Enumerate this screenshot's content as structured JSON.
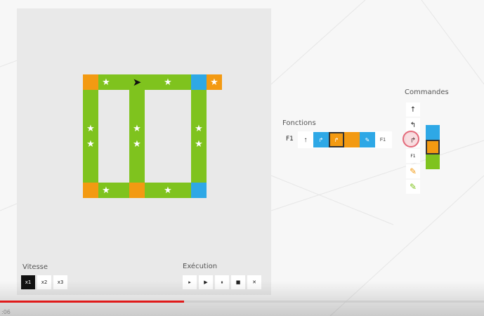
{
  "colors": {
    "green": "#7fc31e",
    "orange": "#f39a12",
    "blue": "#2ea8e6",
    "progress_red": "#e01b1b"
  },
  "board": {
    "tiles": [
      {
        "c": "orange",
        "s": ""
      },
      {
        "c": "green",
        "s": "★"
      },
      {
        "c": "green",
        "s": ""
      },
      {
        "c": "green",
        "s": "➤",
        "arrow": true
      },
      {
        "c": "green",
        "s": ""
      },
      {
        "c": "green",
        "s": "★"
      },
      {
        "c": "green",
        "s": ""
      },
      {
        "c": "blue",
        "s": ""
      },
      {
        "c": "orange",
        "s": "★"
      },
      {
        "c": "green",
        "s": ""
      },
      {
        "c": "green",
        "s": ""
      },
      {
        "c": "green",
        "s": ""
      },
      {
        "c": "green",
        "s": ""
      },
      {
        "c": "green",
        "s": ""
      },
      {
        "c": "green",
        "s": ""
      },
      {
        "c": "green",
        "s": "★"
      },
      {
        "c": "green",
        "s": "★"
      },
      {
        "c": "green",
        "s": "★"
      },
      {
        "c": "green",
        "s": "★"
      },
      {
        "c": "green",
        "s": "★"
      },
      {
        "c": "green",
        "s": "★"
      },
      {
        "c": "green",
        "s": ""
      },
      {
        "c": "green",
        "s": ""
      },
      {
        "c": "green",
        "s": ""
      },
      {
        "c": "green",
        "s": ""
      },
      {
        "c": "green",
        "s": ""
      },
      {
        "c": "green",
        "s": ""
      },
      {
        "c": "orange",
        "s": ""
      },
      {
        "c": "green",
        "s": "★"
      },
      {
        "c": "green",
        "s": ""
      },
      {
        "c": "orange",
        "s": ""
      },
      {
        "c": "green",
        "s": ""
      },
      {
        "c": "green",
        "s": "★"
      },
      {
        "c": "green",
        "s": ""
      },
      {
        "c": "blue",
        "s": ""
      }
    ]
  },
  "speed": {
    "label": "Vitesse",
    "options": [
      {
        "label": "x1",
        "active": true
      },
      {
        "label": "x2",
        "active": false
      },
      {
        "label": "x3",
        "active": false
      }
    ]
  },
  "execution": {
    "label": "Exécution",
    "buttons": [
      {
        "name": "play-step-button",
        "glyph": "▸"
      },
      {
        "name": "play-button",
        "glyph": "▶"
      },
      {
        "name": "pause-button",
        "glyph": "⏸"
      },
      {
        "name": "stop-button",
        "glyph": "■"
      },
      {
        "name": "clear-button",
        "glyph": "✕"
      }
    ]
  },
  "functions": {
    "label": "Fonctions",
    "f1_label": "F1",
    "slots": [
      {
        "style": "white",
        "glyph": "↑",
        "icon": "arrow-up-icon"
      },
      {
        "style": "blue",
        "glyph": "↱",
        "icon": "turn-right-icon"
      },
      {
        "style": "orange",
        "glyph": "↱",
        "icon": "turn-right-icon",
        "selected": true
      },
      {
        "style": "orange",
        "glyph": "",
        "icon": ""
      },
      {
        "style": "blue",
        "glyph": "✎",
        "icon": "pencil-icon"
      },
      {
        "style": "f1txt",
        "glyph": "F1",
        "icon": "f1-call-icon"
      }
    ]
  },
  "commands": {
    "label": "Commandes",
    "items": [
      {
        "name": "cmd-forward",
        "glyph": "↑",
        "icon": "arrow-up-icon",
        "cls": ""
      },
      {
        "name": "cmd-turn-left",
        "glyph": "↰",
        "icon": "turn-left-icon",
        "cls": ""
      },
      {
        "name": "cmd-turn-right",
        "glyph": "↱",
        "icon": "turn-right-icon",
        "cls": ""
      },
      {
        "name": "cmd-f1",
        "glyph": "F1",
        "icon": "f1-call-icon",
        "cls": "small"
      },
      {
        "name": "cmd-paint-orange",
        "glyph": "✎",
        "icon": "pencil-orange-icon",
        "cls": "pencil-orange"
      },
      {
        "name": "cmd-paint-green",
        "glyph": "✎",
        "icon": "pencil-green-icon",
        "cls": "pencil-green"
      }
    ],
    "condition_colors": [
      "blue",
      "orange",
      "green"
    ]
  },
  "video": {
    "progress": 0.38,
    "buffered": 0.71,
    "time": ":06"
  }
}
